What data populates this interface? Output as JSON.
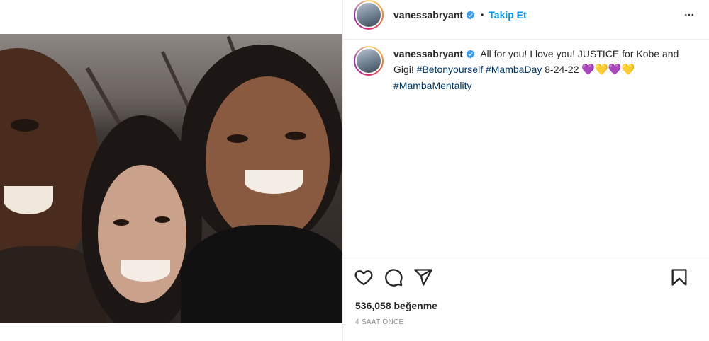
{
  "post": {
    "username": "vanessabryant",
    "follow_label": "Takip Et",
    "dot": "•",
    "caption": {
      "username": "vanessabryant",
      "text": "All for you! I love you! JUSTICE for Kobe and Gigi! ",
      "hashtags": [
        "#Betonyourself",
        "#MambaDay",
        "#MambaMentality"
      ],
      "date": "8-24-22",
      "hearts": [
        "💜",
        "💛",
        "💜",
        "💛"
      ]
    },
    "likes": "536,058 beğenme",
    "time": "4 SAAT ÖNCE"
  },
  "colors": {
    "accent": "#0095f6",
    "hashtag": "#00376b",
    "verified": "#3897f0",
    "heart_purple": "#7a4fd6",
    "heart_yellow": "#f5d400"
  },
  "icons": {
    "verified": "verified-badge-icon",
    "more": "more-options-icon",
    "like": "heart-icon",
    "comment": "comment-icon",
    "share": "send-icon",
    "save": "bookmark-icon"
  }
}
